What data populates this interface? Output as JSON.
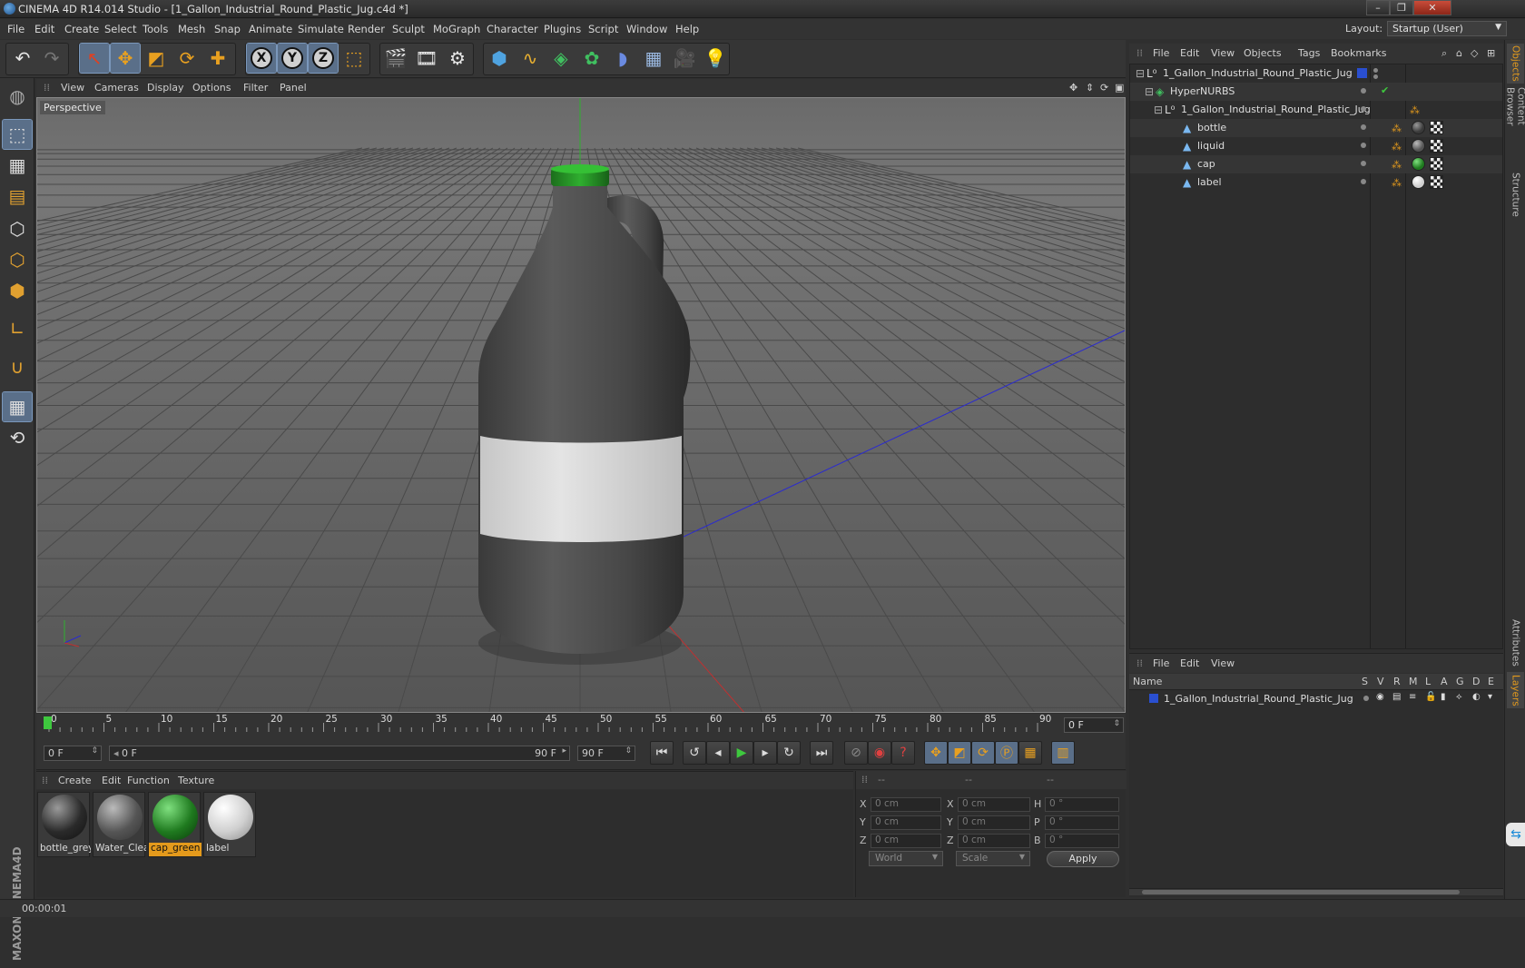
{
  "window": {
    "title": "CINEMA 4D R14.014 Studio - [1_Gallon_Industrial_Round_Plastic_Jug.c4d *]",
    "minimize": "–",
    "maximize": "❐",
    "close": "✕"
  },
  "menubar": {
    "items": [
      "File",
      "Edit",
      "Create",
      "Select",
      "Tools",
      "Mesh",
      "Snap",
      "Animate",
      "Simulate",
      "Render",
      "Sculpt",
      "MoGraph",
      "Character",
      "Plugins",
      "Script",
      "Window",
      "Help"
    ],
    "layout_label": "Layout:",
    "layout_value": "Startup (User)"
  },
  "toolbar": {
    "undo_icon": "undo-icon",
    "redo_icon": "redo-icon",
    "axis_labels": [
      "X",
      "Y",
      "Z"
    ]
  },
  "viewport": {
    "menu": [
      "View",
      "Cameras",
      "Display",
      "Options",
      "Filter",
      "Panel"
    ],
    "label": "Perspective"
  },
  "timeline": {
    "ticks": [
      "0",
      "5",
      "10",
      "15",
      "20",
      "25",
      "30",
      "35",
      "40",
      "45",
      "50",
      "55",
      "60",
      "65",
      "70",
      "75",
      "80",
      "85",
      "90"
    ],
    "current_frame": "0 F",
    "start_field": "0 F",
    "range_start": "0 F",
    "range_end": "90 F",
    "end_field": "90 F"
  },
  "materials": {
    "menu": [
      "Create",
      "Edit",
      "Function",
      "Texture"
    ],
    "items": [
      {
        "name": "bottle_grey",
        "color": "#3a3a3a"
      },
      {
        "name": "Water_Clea",
        "color": "#555555"
      },
      {
        "name": "cap_green",
        "color": "#1f7a1f"
      },
      {
        "name": "label",
        "color": "#d8d8d8"
      }
    ],
    "selected": "cap_green"
  },
  "coordinates": {
    "header": [
      "--",
      "--",
      "--"
    ],
    "rows": [
      {
        "a": "X",
        "v1": "0 cm",
        "b": "X",
        "v2": "0 cm",
        "c": "H",
        "v3": "0 °"
      },
      {
        "a": "Y",
        "v1": "0 cm",
        "b": "Y",
        "v2": "0 cm",
        "c": "P",
        "v3": "0 °"
      },
      {
        "a": "Z",
        "v1": "0 cm",
        "b": "Z",
        "v2": "0 cm",
        "c": "B",
        "v3": "0 °"
      }
    ],
    "world": "World",
    "scale": "Scale",
    "apply": "Apply"
  },
  "status": {
    "time": "00:00:01"
  },
  "objects": {
    "menu": [
      "File",
      "Edit",
      "View",
      "Objects",
      "Tags",
      "Bookmarks"
    ],
    "tree": [
      {
        "name": "1_Gallon_Industrial_Round_Plastic_Jug",
        "depth": 0,
        "icon": "null-object-icon"
      },
      {
        "name": "HyperNURBS",
        "depth": 1,
        "icon": "hypernurbs-icon"
      },
      {
        "name": "1_Gallon_Industrial_Round_Plastic_Jug",
        "depth": 2,
        "icon": "null-object-icon"
      },
      {
        "name": "bottle",
        "depth": 3,
        "icon": "polygon-object-icon",
        "mat": "#3a3a3a"
      },
      {
        "name": "liquid",
        "depth": 3,
        "icon": "polygon-object-icon",
        "mat": "#555555"
      },
      {
        "name": "cap",
        "depth": 3,
        "icon": "polygon-object-icon",
        "mat": "#1f7a1f"
      },
      {
        "name": "label",
        "depth": 3,
        "icon": "polygon-object-icon",
        "mat": "#d8d8d8"
      }
    ]
  },
  "layers": {
    "menu": [
      "File",
      "Edit",
      "View"
    ],
    "columns": [
      "Name",
      "S",
      "V",
      "R",
      "M",
      "L",
      "A",
      "G",
      "D",
      "E"
    ],
    "rows": [
      {
        "name": "1_Gallon_Industrial_Round_Plastic_Jug",
        "color": "#2a4fd0"
      }
    ]
  },
  "right_tabs": [
    "Objects",
    "Content Browser",
    "Structure",
    "Attributes",
    "Layers"
  ]
}
